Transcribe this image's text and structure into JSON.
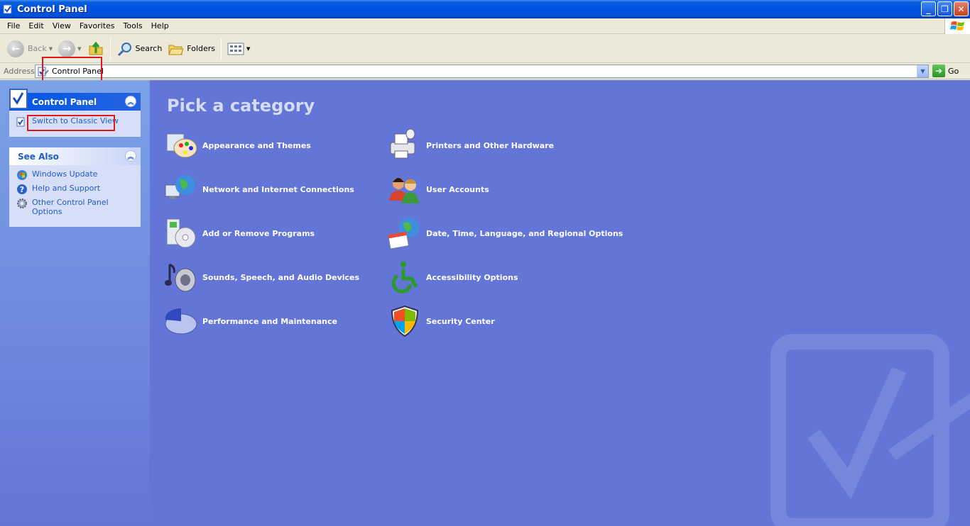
{
  "window": {
    "title": "Control Panel"
  },
  "menu": [
    "File",
    "Edit",
    "View",
    "Favorites",
    "Tools",
    "Help"
  ],
  "toolbar": {
    "back": "Back",
    "search": "Search",
    "folders": "Folders"
  },
  "address": {
    "label": "Address",
    "value": "Control Panel",
    "go": "Go"
  },
  "left": {
    "control_panel": {
      "title": "Control Panel",
      "switch": "Switch to Classic View"
    },
    "see_also": {
      "title": "See Also",
      "items": [
        "Windows Update",
        "Help and Support",
        "Other Control Panel Options"
      ]
    }
  },
  "main": {
    "title": "Pick a category",
    "categories": [
      "Appearance and Themes",
      "Printers and Other Hardware",
      "Network and Internet Connections",
      "User Accounts",
      "Add or Remove Programs",
      "Date, Time, Language, and Regional Options",
      "Sounds, Speech, and Audio Devices",
      "Accessibility Options",
      "Performance and Maintenance",
      "Security Center"
    ]
  },
  "icons": {
    "appearance": "appearance-themes-icon",
    "printers": "printer-icon",
    "network": "network-globe-icon",
    "users": "user-accounts-icon",
    "programs": "add-remove-programs-icon",
    "datetime": "date-time-globe-icon",
    "sounds": "sound-speaker-icon",
    "accessibility": "accessibility-wheelchair-icon",
    "performance": "performance-pie-icon",
    "security": "security-shield-icon"
  },
  "colors": {
    "titlebar": "#0054e3",
    "main_bg": "#6375d6",
    "link": "#215dc6",
    "highlight": "#e3161b"
  }
}
